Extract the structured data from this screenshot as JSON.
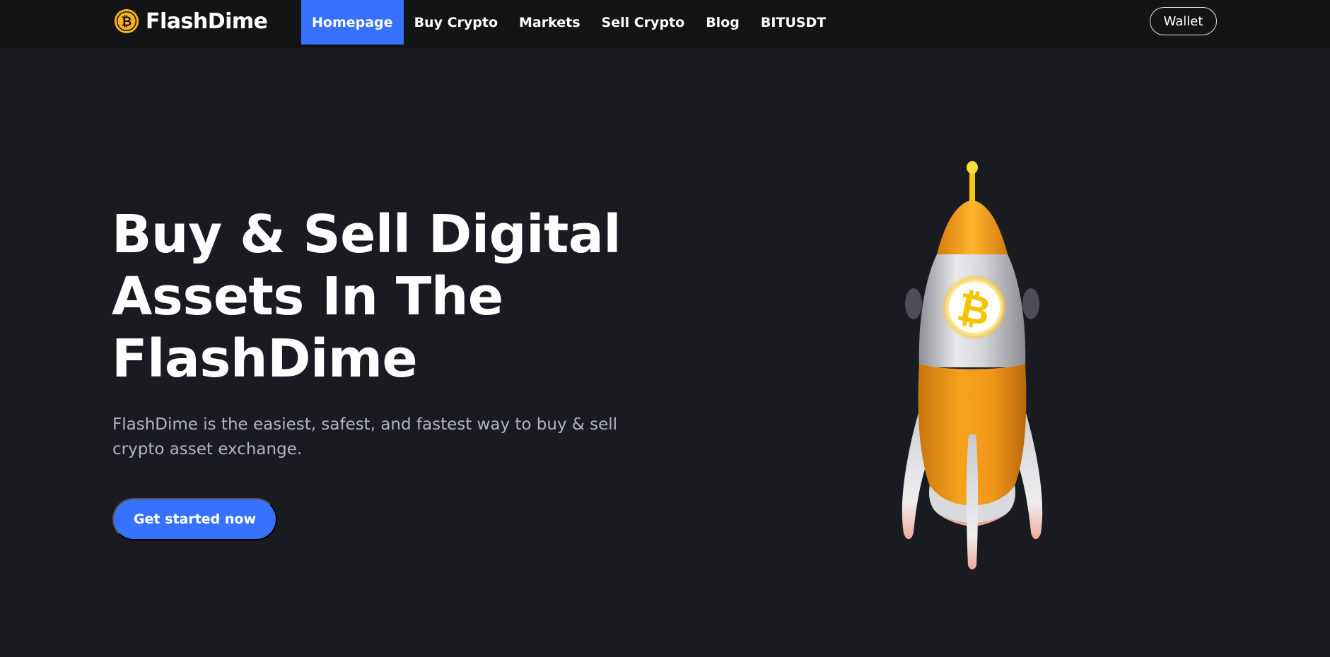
{
  "brand": {
    "name": "FlashDime",
    "logo_icon": "bitcoin-coin-icon",
    "logo_glyph": "₿"
  },
  "nav": {
    "items": [
      {
        "label": "Homepage",
        "active": true
      },
      {
        "label": "Buy Crypto",
        "active": false
      },
      {
        "label": "Markets",
        "active": false
      },
      {
        "label": "Sell Crypto",
        "active": false
      },
      {
        "label": "Blog",
        "active": false
      },
      {
        "label": "BITUSDT",
        "active": false
      }
    ]
  },
  "header": {
    "wallet_label": "Wallet"
  },
  "hero": {
    "title_lines": [
      "Buy & Sell Digital",
      "Assets In The",
      "FlashDime"
    ],
    "subtitle_lines": [
      "FlashDime is the easiest, safest, and fastest way to buy & sell",
      "crypto asset exchange."
    ],
    "cta_label": "Get started now",
    "illustration": "bitcoin-rocket-illustration",
    "illustration_glyph": "₿"
  },
  "colors": {
    "background": "#1a1b20",
    "navbar": "#141417",
    "accent": "#3772ff",
    "subtitle_text": "#b1b5c3",
    "coin_gold": "#f5b324"
  }
}
